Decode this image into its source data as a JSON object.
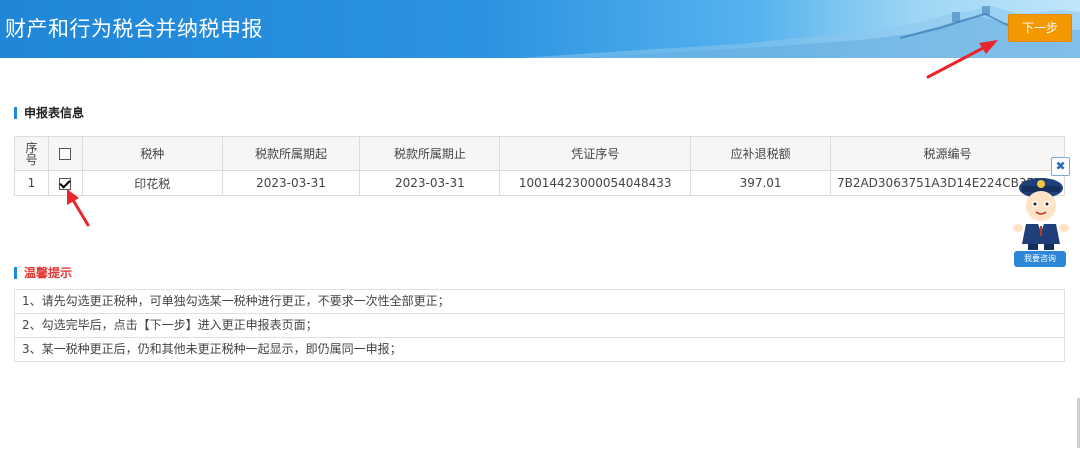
{
  "header": {
    "title": "财产和行为税合并纳税申报",
    "next_label": "下一步"
  },
  "section": {
    "info_title": "申报表信息",
    "tips_title": "温馨提示"
  },
  "table": {
    "columns": [
      "序号",
      "",
      "税种",
      "税款所属期起",
      "税款所属期止",
      "凭证序号",
      "应补退税额",
      "税源编号"
    ],
    "rows": [
      {
        "index": "1",
        "checked": true,
        "tax_type": "印花税",
        "period_start": "2023-03-31",
        "period_end": "2023-03-31",
        "voucher_no": "10014423000054048433",
        "amount": "397.01",
        "source_no": "7B2AD3063751A3D14E224CB3FFD"
      }
    ]
  },
  "tips": [
    "1、请先勾选更正税种，可单独勾选某一税种进行更正，不要求一次性全部更正；",
    "2、勾选完毕后，点击【下一步】进入更正申报表页面；",
    "3、某一税种更正后，仍和其他未更正税种一起显示，即仍属同一申报；"
  ],
  "widget": {
    "consult_label": "我要咨询",
    "close_label": "✖"
  },
  "colors": {
    "header_blue": "#1f86d8",
    "button_orange": "#f39800",
    "arrow_red": "#e8262b",
    "section_accent": "#1e88e5"
  }
}
